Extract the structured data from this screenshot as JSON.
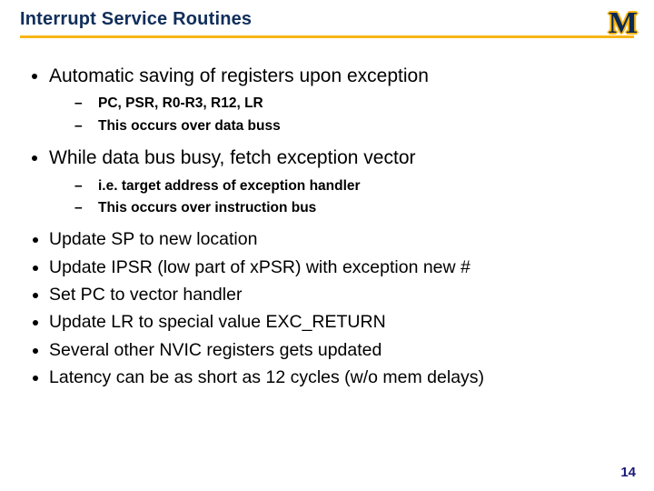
{
  "title": "Interrupt Service Routines",
  "logo": "M",
  "bullets": {
    "b1": "Automatic saving of registers upon exception",
    "b1s1": "PC, PSR, R0-R3, R12, LR",
    "b1s2": "This occurs over data buss",
    "b2": "While data bus busy, fetch exception vector",
    "b2s1": "i.e. target address of exception handler",
    "b2s2": "This occurs over instruction bus",
    "b3": "Update SP to new location",
    "b4": "Update IPSR (low part of xPSR) with exception new #",
    "b5": "Set PC to vector handler",
    "b6": "Update LR to special value EXC_RETURN",
    "b7": "Several other NVIC registers gets updated",
    "b8": "Latency can be as short as 12 cycles (w/o mem delays)"
  },
  "pagenum": "14"
}
